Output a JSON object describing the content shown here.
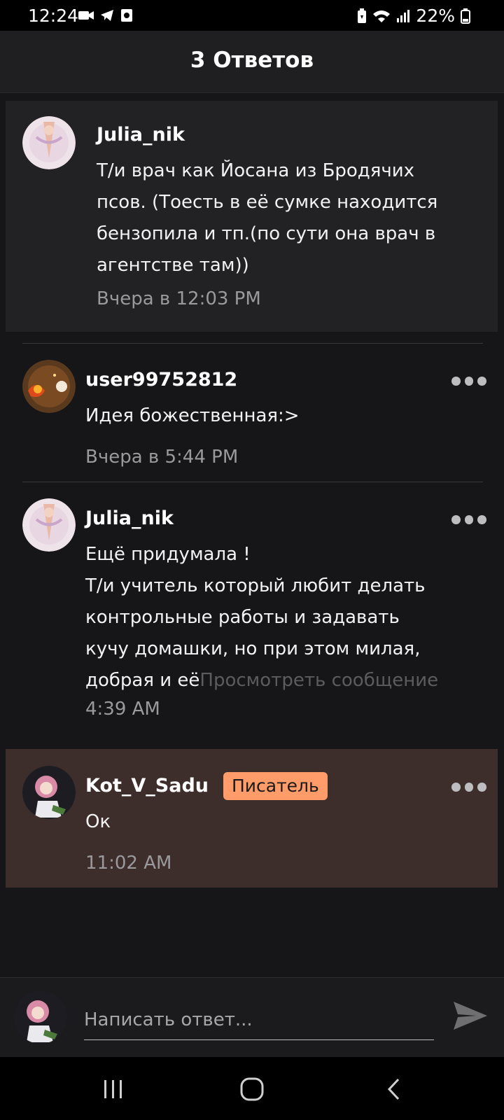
{
  "status_bar": {
    "time": "12:24",
    "battery": "22%"
  },
  "header": {
    "title": "3 Ответов"
  },
  "parent_comment": {
    "username": "Julia_nik",
    "text": "Т/и врач как Йосана  из Бродячих\nпсов. (Тоесть в её сумке находится\nбензопила и тп.(по сути она врач в\nагентстве там))",
    "timestamp": "Вчера в 12:03 PM"
  },
  "replies": [
    {
      "username": "user99752812",
      "text": "Идея божественная:>",
      "timestamp": "Вчера в 5:44 PM"
    },
    {
      "username": "Julia_nik",
      "text": "Ещё придумала  !\nТ/и учитель который любит делать\nконтрольные работы  и задавать\nкучу домашки, но при этом милая,\nдобрая и её",
      "view_more": "Просмотреть сообщение",
      "timestamp": "4:39 AM"
    },
    {
      "username": "Kot_V_Sadu",
      "badge": "Писатель",
      "text": "Ок",
      "timestamp": "11:02 AM"
    }
  ],
  "composer": {
    "placeholder": "Написать ответ..."
  },
  "icons": {
    "status_left": [
      "video-icon",
      "telegram-icon",
      "screenshot-icon"
    ],
    "status_right": [
      "battery-saver-icon",
      "wifi-icon",
      "signal-icon",
      "battery-icon"
    ],
    "send": "send-icon",
    "nav": [
      "recent-apps-icon",
      "home-icon",
      "back-icon"
    ]
  },
  "colors": {
    "background": "#161517",
    "header": "#1f1e21",
    "highlight": "#3e2e2b",
    "badge": "#ff9c6a",
    "timestamp": "#9a999c"
  }
}
